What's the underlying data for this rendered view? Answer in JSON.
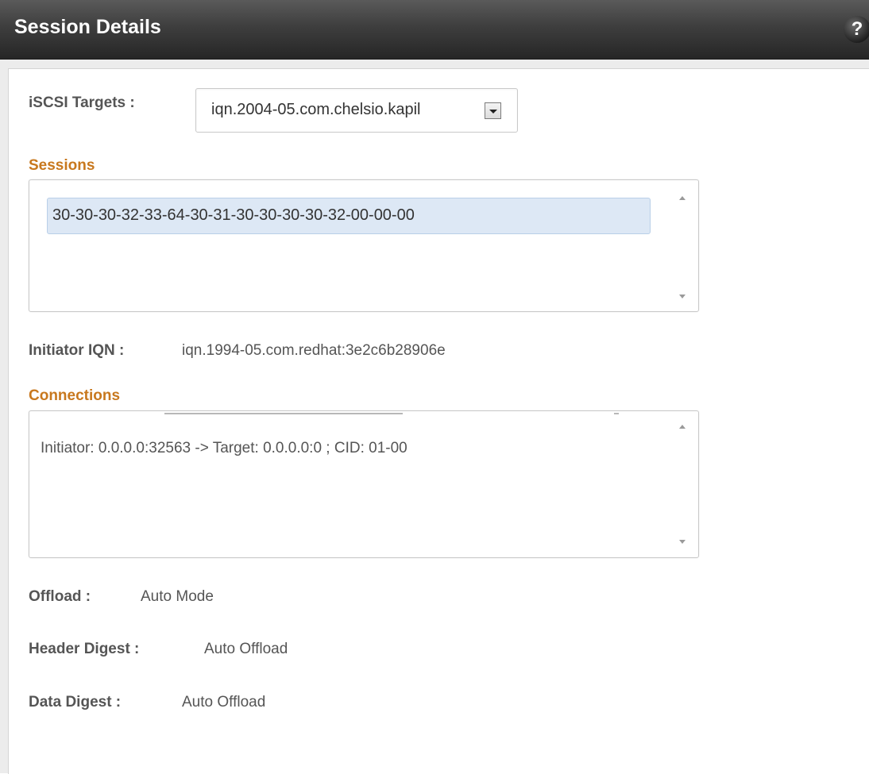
{
  "header": {
    "title": "Session Details",
    "help_label": "?"
  },
  "targets": {
    "label": "iSCSI Targets :",
    "selected": "iqn.2004-05.com.chelsio.kapil"
  },
  "sessions": {
    "heading": "Sessions",
    "items": [
      "30-30-30-32-33-64-30-31-30-30-30-30-32-00-00-00"
    ]
  },
  "initiator": {
    "label": "Initiator IQN :",
    "value": "iqn.1994-05.com.redhat:3e2c6b28906e"
  },
  "connections": {
    "heading": "Connections",
    "items": [
      "Initiator: 0.0.0.0:32563 -> Target: 0.0.0.0:0 ; CID: 01-00"
    ]
  },
  "offload": {
    "label": "Offload :",
    "value": "Auto Mode"
  },
  "header_digest": {
    "label": "Header Digest :",
    "value": "Auto Offload"
  },
  "data_digest": {
    "label": "Data Digest :",
    "value": "Auto Offload"
  },
  "colors": {
    "section_heading": "#c8781e",
    "titlebar": "#2e2e2e",
    "selected_item": "#dde8f5"
  }
}
